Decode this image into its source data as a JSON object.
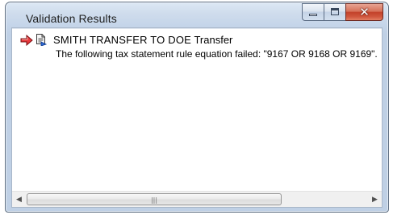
{
  "window": {
    "title": "Validation Results"
  },
  "message": {
    "icons": [
      "arrow-right-icon",
      "document-icon"
    ],
    "title": "SMITH TRANSFER TO DOE",
    "type": "Transfer",
    "body": "The following tax statement rule equation failed:  \"9167 OR 9168 OR 9169\"."
  },
  "scrollbar": {
    "grip": "|||"
  },
  "colors": {
    "close_button": "#c2412a",
    "frame": "#bfd0e5",
    "arrow_icon": "#d6272b"
  }
}
